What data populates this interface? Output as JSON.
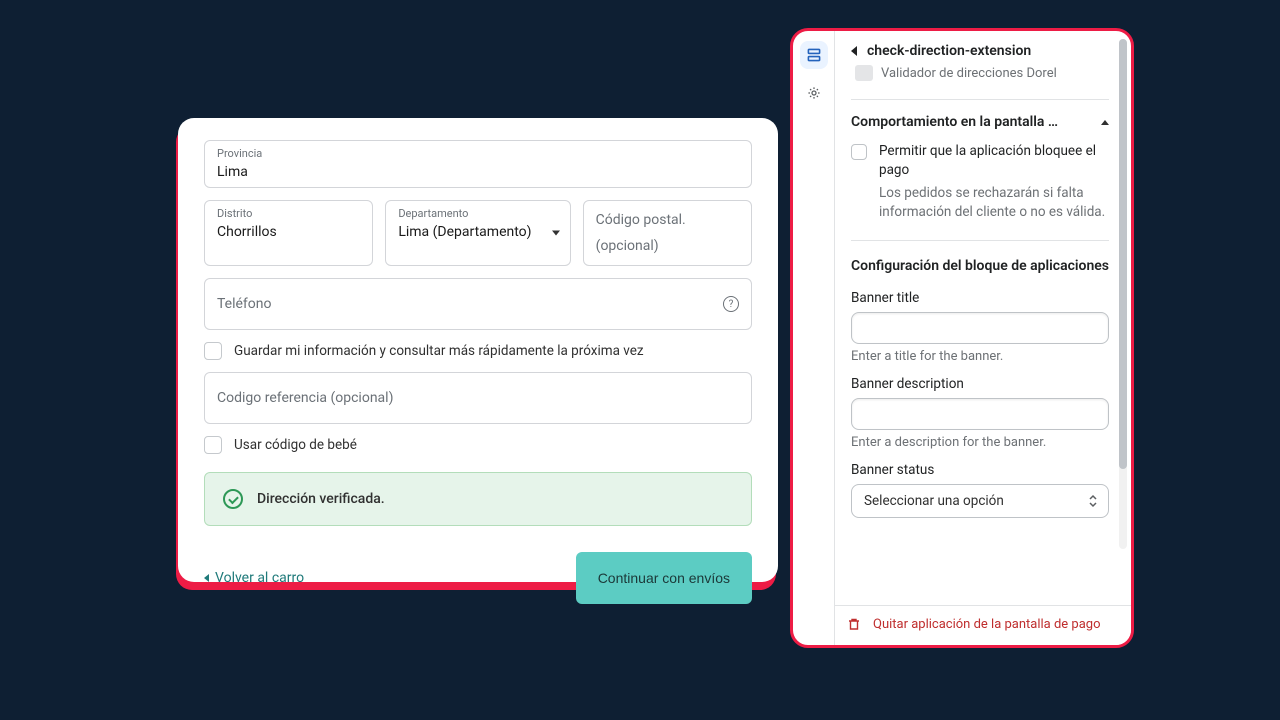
{
  "checkout": {
    "province_label": "Provincia",
    "province_value": "Lima",
    "district_label": "Distrito",
    "district_value": "Chorrillos",
    "department_label": "Departamento",
    "department_value": "Lima (Departamento)",
    "postal_placeholder": "Código postal. (opcional)",
    "phone_placeholder": "Teléfono",
    "save_info_label": "Guardar mi información y consultar más rápidamente la próxima vez",
    "ref_code_placeholder": "Codigo referencia (opcional)",
    "baby_code_label": "Usar código de bebé",
    "verified_text": "Dirección verificada.",
    "back_link": "Volver al carro",
    "continue_button": "Continuar con envíos"
  },
  "panel": {
    "title": "check-direction-extension",
    "subtitle": "Validador de direcciones Dorel",
    "accordion_title": "Comportamiento en la pantalla d…",
    "block_payment_label": "Permitir que la aplicación bloquee el pago",
    "block_payment_help": "Los pedidos se rechazarán si falta información del cliente o no es válida.",
    "section2_title": "Configuración del bloque de aplicaciones",
    "banner_title_label": "Banner title",
    "banner_title_help": "Enter a title for the banner.",
    "banner_desc_label": "Banner description",
    "banner_desc_help": "Enter a description for the banner.",
    "banner_status_label": "Banner status",
    "banner_status_placeholder": "Seleccionar una opción",
    "remove_label": "Quitar aplicación de la pantalla de pago"
  }
}
